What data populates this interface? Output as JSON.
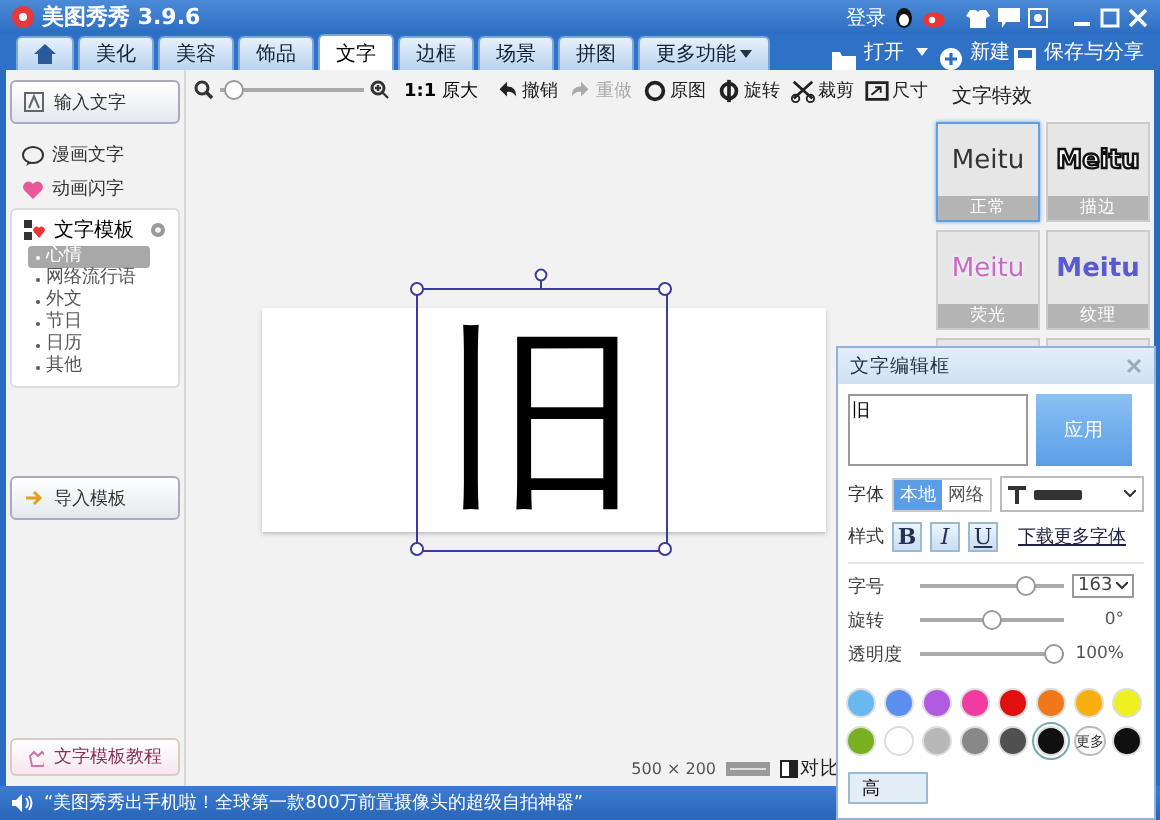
{
  "window": {
    "title": "美图秀秀 3.9.6",
    "login": "登录"
  },
  "tabs": [
    {
      "kind": "home",
      "selected": false
    },
    {
      "label": "美化",
      "kind": "text",
      "selected": false
    },
    {
      "label": "美容",
      "kind": "text",
      "selected": false
    },
    {
      "label": "饰品",
      "kind": "text",
      "selected": false
    },
    {
      "label": "文字",
      "kind": "text",
      "selected": true
    },
    {
      "label": "边框",
      "kind": "text",
      "selected": false
    },
    {
      "label": "场景",
      "kind": "text",
      "selected": false
    },
    {
      "label": "拼图",
      "kind": "text",
      "selected": false
    },
    {
      "label": "更多功能",
      "kind": "menu",
      "selected": false
    }
  ],
  "actions": [
    {
      "label": "打开",
      "kind": "open"
    },
    {
      "label": "新建",
      "kind": "new"
    },
    {
      "label": "保存与分享",
      "kind": "save"
    }
  ],
  "toolbar": {
    "zoom": {
      "level": 0.03
    },
    "actual_size": "**1:1** 原大",
    "tools": [
      {
        "label": "撤销",
        "kind": "undo",
        "disabled": false
      },
      {
        "label": "重做",
        "kind": "redo",
        "disabled": true
      },
      {
        "label": "原图",
        "kind": "original",
        "disabled": false
      },
      {
        "label": "旋转",
        "kind": "rotate",
        "disabled": false
      },
      {
        "label": "裁剪",
        "kind": "crop",
        "disabled": false
      },
      {
        "label": "尺寸",
        "kind": "resize",
        "disabled": false
      }
    ]
  },
  "sidebar": {
    "input_button": "输入文字",
    "items": [
      {
        "label": "漫画文字",
        "kind": "comic"
      },
      {
        "label": "动画闪字",
        "kind": "flash"
      }
    ],
    "templates": {
      "label": "文字模板",
      "children": [
        {
          "label": "心情",
          "selected": true
        },
        {
          "label": "网络流行语",
          "selected": false
        },
        {
          "label": "外文",
          "selected": false
        },
        {
          "label": "节日",
          "selected": false
        },
        {
          "label": "日历",
          "selected": false
        },
        {
          "label": "其他",
          "selected": false
        }
      ]
    },
    "import_button": "导入模板",
    "tutorial_button": "文字模板教程"
  },
  "canvas": {
    "text": "旧",
    "dimensions": "500 × 200",
    "compare": "对比"
  },
  "effects": {
    "title": "文字特效",
    "tiles": [
      {
        "sample": "Meitu",
        "label": "正常",
        "kind": "plain",
        "selected": true
      },
      {
        "sample": "Meitu",
        "label": "描边",
        "kind": "outline",
        "selected": false
      },
      {
        "sample": "Meitu",
        "label": "荧光",
        "kind": "glow",
        "selected": false
      },
      {
        "sample": "Meitu",
        "label": "纹理",
        "kind": "texture",
        "selected": false
      },
      {
        "kind": "blank",
        "selected": false
      },
      {
        "kind": "blank",
        "selected": false
      }
    ]
  },
  "editor": {
    "title": "文字编辑框",
    "value": "旧",
    "apply": "应用",
    "font_label": "字体",
    "sources": [
      {
        "label": "本地",
        "selected": true
      },
      {
        "label": "网络",
        "selected": false
      }
    ],
    "style_label": "样式",
    "styles": [
      {
        "label": "B",
        "kind": "bold"
      },
      {
        "label": "I",
        "kind": "italic"
      },
      {
        "label": "U",
        "kind": "underline"
      }
    ],
    "download": "下载更多字体",
    "sliders": [
      {
        "label": "字号",
        "level": 0.77,
        "value": "163",
        "kind": "select"
      },
      {
        "label": "旋转",
        "level": 0.5,
        "value": "0°",
        "kind": "text"
      },
      {
        "label": "透明度",
        "level": 1,
        "value": "100%",
        "kind": "text"
      }
    ],
    "colors": [
      {
        "color": "#6ab8f0",
        "selected": false
      },
      {
        "color": "#5c8ef0",
        "selected": false
      },
      {
        "color": "#b05ce0",
        "selected": false
      },
      {
        "color": "#f03ca0",
        "selected": false
      },
      {
        "color": "#e01010",
        "selected": false
      },
      {
        "color": "#f07818",
        "selected": false
      },
      {
        "color": "#f8b010",
        "selected": false
      },
      {
        "color": "#eef020",
        "selected": false
      },
      {
        "color": "#78b020",
        "selected": false
      },
      {
        "color": "#ffffff",
        "selected": false
      },
      {
        "color": "#b8b8b8",
        "selected": false
      },
      {
        "color": "#888888",
        "selected": false
      },
      {
        "color": "#505050",
        "selected": false
      },
      {
        "color": "#101010",
        "selected": true
      },
      {
        "color": "#101010",
        "selected": false
      }
    ],
    "more": "更多",
    "bottom_button": "高"
  },
  "status": {
    "message": "“美图秀秀出手机啦！全球第一款800万前置摄像头的超级自拍神器”"
  }
}
